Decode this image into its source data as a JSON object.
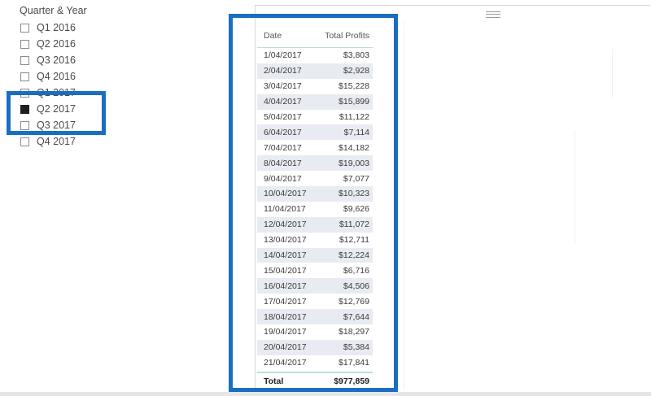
{
  "slicer": {
    "title": "Quarter & Year",
    "items": [
      {
        "label": "Q1 2016",
        "checked": false
      },
      {
        "label": "Q2 2016",
        "checked": false
      },
      {
        "label": "Q3 2016",
        "checked": false
      },
      {
        "label": "Q4 2016",
        "checked": false
      },
      {
        "label": "Q1 2017",
        "checked": false
      },
      {
        "label": "Q2 2017",
        "checked": true
      },
      {
        "label": "Q3 2017",
        "checked": false
      },
      {
        "label": "Q4 2017",
        "checked": false
      }
    ]
  },
  "table": {
    "headers": [
      "Date",
      "Total Profits"
    ],
    "rows": [
      [
        "1/04/2017",
        "$3,803"
      ],
      [
        "2/04/2017",
        "$2,928"
      ],
      [
        "3/04/2017",
        "$15,228"
      ],
      [
        "4/04/2017",
        "$15,899"
      ],
      [
        "5/04/2017",
        "$11,122"
      ],
      [
        "6/04/2017",
        "$7,114"
      ],
      [
        "7/04/2017",
        "$14,182"
      ],
      [
        "8/04/2017",
        "$19,003"
      ],
      [
        "9/04/2017",
        "$7,077"
      ],
      [
        "10/04/2017",
        "$10,323"
      ],
      [
        "11/04/2017",
        "$9,626"
      ],
      [
        "12/04/2017",
        "$11,072"
      ],
      [
        "13/04/2017",
        "$12,711"
      ],
      [
        "14/04/2017",
        "$12,224"
      ],
      [
        "15/04/2017",
        "$6,716"
      ],
      [
        "16/04/2017",
        "$4,506"
      ],
      [
        "17/04/2017",
        "$12,769"
      ],
      [
        "18/04/2017",
        "$7,644"
      ],
      [
        "19/04/2017",
        "$18,297"
      ],
      [
        "20/04/2017",
        "$5,384"
      ],
      [
        "21/04/2017",
        "$17,841"
      ]
    ],
    "total_label": "Total",
    "total_value": "$977,859"
  },
  "colors": {
    "highlight": "#1a6ec2",
    "row_shade": "#e8ebf2",
    "header_rule": "#b9e0de"
  }
}
